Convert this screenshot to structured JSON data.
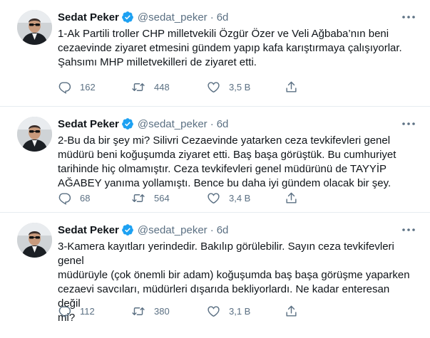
{
  "colors": {
    "accent": "#1da1f2",
    "text": "#0f1419",
    "secondary": "#5b7083",
    "divider": "#e6ecf0"
  },
  "tweets": [
    {
      "name": "Sedat Peker",
      "handle": "@sedat_peker",
      "separator": "·",
      "time": "6d",
      "text": "1-Ak Partili troller CHP milletvekili Özgür Özer ve Veli Ağbaba’nın beni\ncezaevinde ziyaret etmesini gündem yapıp kafa karıştırmaya çalışıyorlar.\nŞahsımı MHP milletvekilleri de ziyaret etti.",
      "replies": "162",
      "retweets": "448",
      "likes": "3,5 B"
    },
    {
      "name": "Sedat Peker",
      "handle": "@sedat_peker",
      "separator": "·",
      "time": "6d",
      "text": "2-Bu da bir şey mi? Silivri Cezaevinde yatarken ceza tevkifevleri genel\nmüdürü beni koğuşumda ziyaret etti. Baş başa görüştük. Bu cumhuriyet\ntarihinde hiç olmamıştır. Ceza tevkifevleri genel müdürünü de TAYYİP\nAĞABEY yanıma yollamıştı. Bence bu daha iyi gündem olacak bir şey.",
      "replies": "68",
      "retweets": "564",
      "likes": "3,4 B"
    },
    {
      "name": "Sedat Peker",
      "handle": "@sedat_peker",
      "separator": "·",
      "time": "6d",
      "text": "3-Kamera kayıtları yerindedir. Bakılıp görülebilir. Sayın ceza tevkifevleri genel\nmüdürüyle (çok önemli bir adam) koğuşumda baş başa görüşme yaparken\ncezaevi savcıları, müdürleri dışarıda bekliyorlardı. Ne kadar enteresan değil\nmi?",
      "replies": "112",
      "retweets": "380",
      "likes": "3,1 B"
    }
  ]
}
